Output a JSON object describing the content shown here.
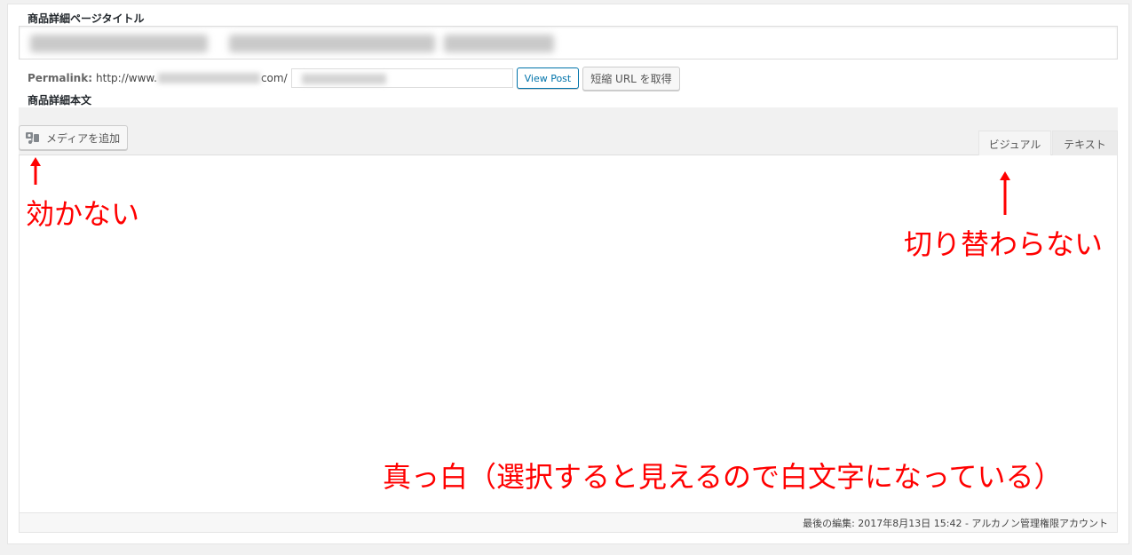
{
  "post": {
    "title_label": "商品詳細ページタイトル",
    "permalink_label": "Permalink:",
    "permalink_prefix": "http://www.",
    "permalink_suffix": "com/",
    "view_post_label": "View Post",
    "shortlink_label": "短縮 URL を取得",
    "body_label": "商品詳細本文"
  },
  "editor": {
    "add_media_label": "メディアを追加",
    "tabs": [
      {
        "label": "ビジュアル",
        "active": true
      },
      {
        "label": "テキスト",
        "active": false
      }
    ],
    "status_text": "最後の編集: 2017年8月13日 15:42 - アルカノン管理権限アカウント"
  },
  "annotations": {
    "media_note": "効かない",
    "tabs_note": "切り替わらない",
    "editor_note": "真っ白（選択すると見えるので白文字になっている）"
  },
  "colors": {
    "annotation": "#ff0000",
    "primary": "#0073aa"
  }
}
